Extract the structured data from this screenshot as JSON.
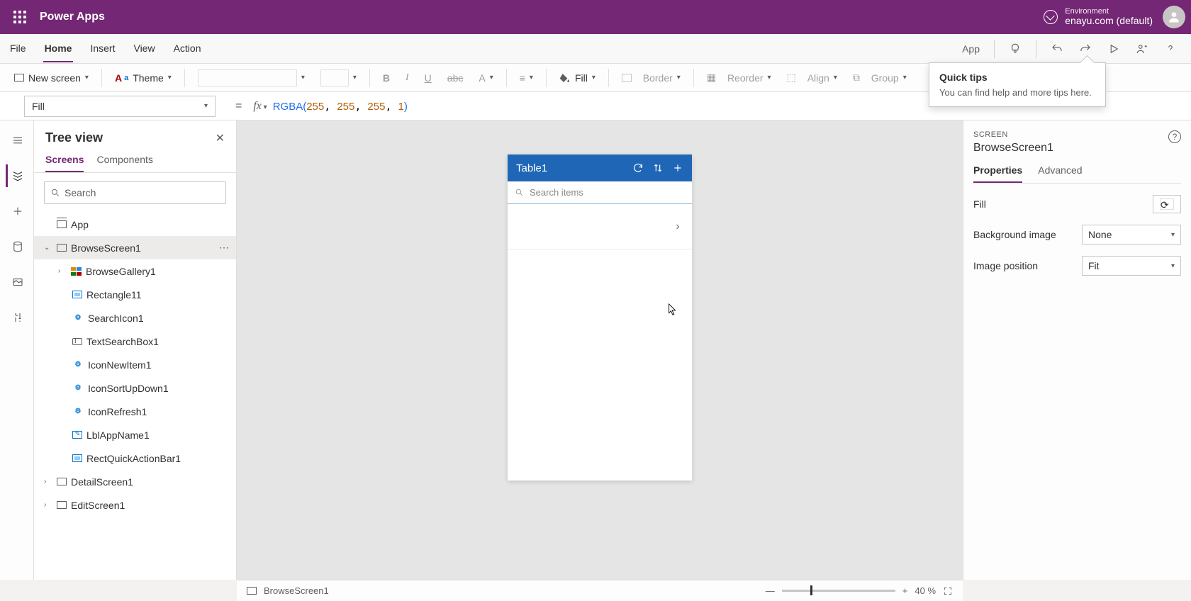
{
  "topbar": {
    "app_title": "Power Apps",
    "env_label": "Environment",
    "env_name": "enayu.com (default)"
  },
  "menu": {
    "tabs": [
      "File",
      "Home",
      "Insert",
      "View",
      "Action"
    ],
    "active_tab": "Home",
    "app_btn": "App"
  },
  "toolbar": {
    "new_screen": "New screen",
    "theme": "Theme",
    "fill": "Fill",
    "border": "Border",
    "reorder": "Reorder",
    "align": "Align",
    "group": "Group"
  },
  "formula": {
    "prop": "Fill",
    "fn": "RGBA",
    "args": [
      "255",
      "255",
      "255",
      "1"
    ]
  },
  "tree": {
    "title": "Tree view",
    "tabs": [
      "Screens",
      "Components"
    ],
    "search_placeholder": "Search",
    "items": [
      {
        "label": "App"
      },
      {
        "label": "BrowseScreen1"
      },
      {
        "label": "BrowseGallery1"
      },
      {
        "label": "Rectangle11"
      },
      {
        "label": "SearchIcon1"
      },
      {
        "label": "TextSearchBox1"
      },
      {
        "label": "IconNewItem1"
      },
      {
        "label": "IconSortUpDown1"
      },
      {
        "label": "IconRefresh1"
      },
      {
        "label": "LblAppName1"
      },
      {
        "label": "RectQuickActionBar1"
      },
      {
        "label": "DetailScreen1"
      },
      {
        "label": "EditScreen1"
      }
    ]
  },
  "canvas": {
    "header_title": "Table1",
    "search_placeholder": "Search items"
  },
  "props": {
    "section_label": "SCREEN",
    "name": "BrowseScreen1",
    "tabs": [
      "Properties",
      "Advanced"
    ],
    "fill_label": "Fill",
    "bg_label": "Background image",
    "bg_value": "None",
    "pos_label": "Image position",
    "pos_value": "Fit"
  },
  "tooltip": {
    "title": "Quick tips",
    "body": "You can find help and more tips here."
  },
  "status": {
    "screen": "BrowseScreen1",
    "zoom": "40",
    "zoom_unit": "%"
  }
}
